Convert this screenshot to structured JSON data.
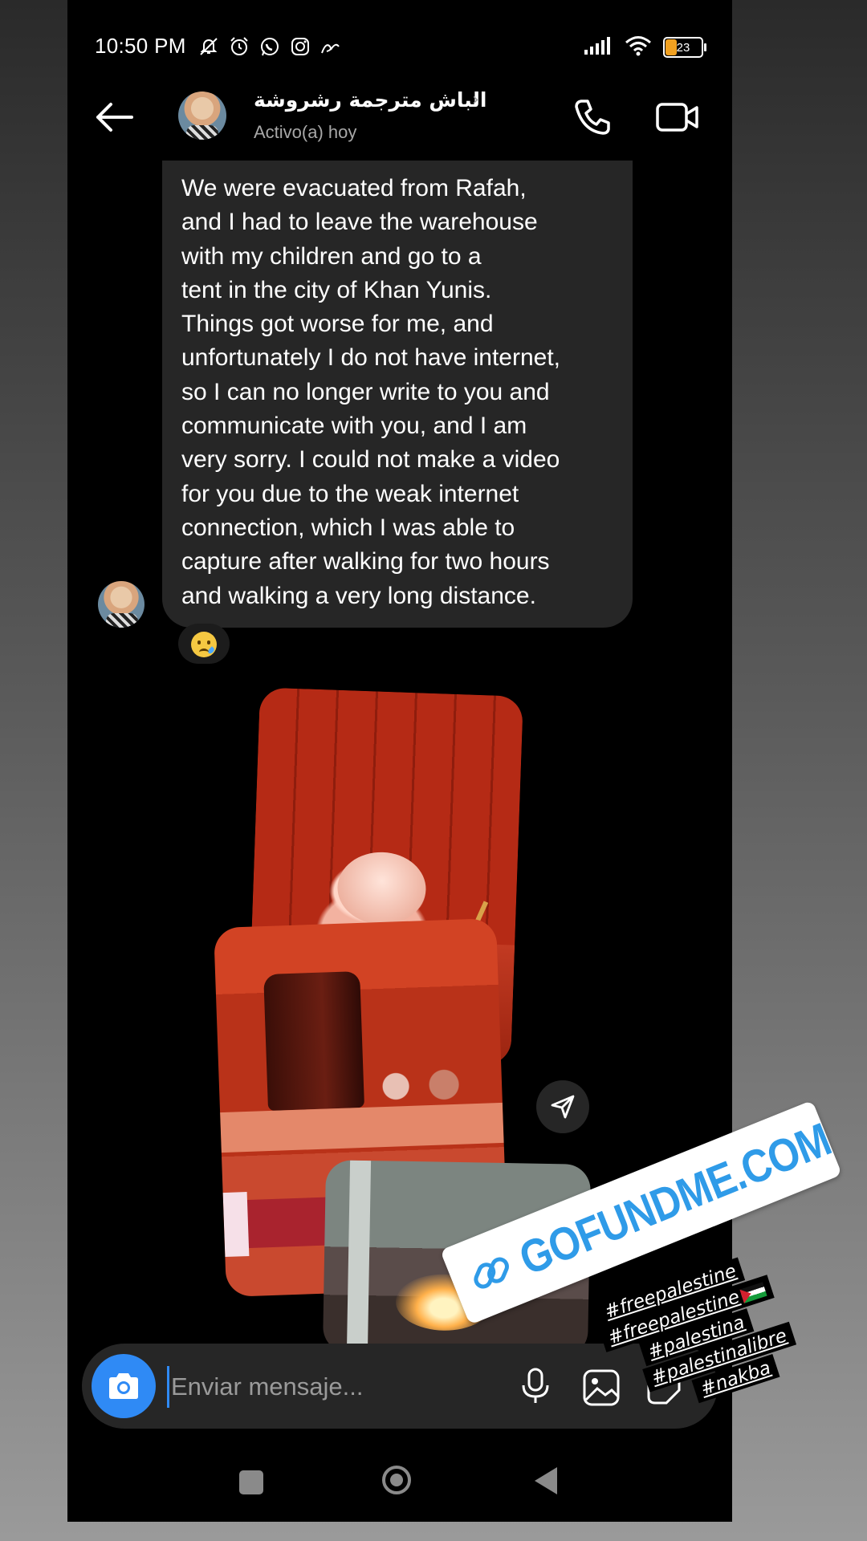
{
  "status_bar": {
    "time": "10:50 PM",
    "battery": "23",
    "left_icons": [
      "mute-icon",
      "alarm-icon",
      "whatsapp-icon",
      "instagram-icon",
      "signature-icon"
    ],
    "right_icons": [
      "signal-icon",
      "wifi-icon",
      "battery-icon"
    ]
  },
  "header": {
    "contact_name": "الباش مترجمة رشروشة",
    "contact_status": "Activo(a) hoy",
    "icons": [
      "back-arrow-icon",
      "phone-icon",
      "video-camera-icon",
      "chevron-right-icon"
    ]
  },
  "message": {
    "text": "We were evacuated from Rafah,\nand I had to leave the warehouse\nwith my children and go to a\ntent in the city of Khan Yunis.\nThings got worse for me, and\nunfortunately I do not have internet,\nso I can no longer write to you and\ncommunicate with you, and I am\nvery sorry. I could not make a video\nfor you due to the weak internet\nconnection, which I was able to\ncapture after walking for two hours\nand walking a very long distance.",
    "reaction": "crying-face-emoji"
  },
  "composer": {
    "placeholder": "Enviar mensaje...",
    "icons": [
      "camera-icon",
      "microphone-icon",
      "gallery-icon",
      "sticker-icon"
    ]
  },
  "stickers": {
    "link_text": "GOFUNDME.COM",
    "hashtags": [
      "#freepalestine",
      "#freepalestine",
      "#palestina",
      "#palestinalibre",
      "#nakba"
    ]
  },
  "colors": {
    "accent": "#2f8af5",
    "bubble": "#262626",
    "link_sticker_text": "#2f9be8"
  }
}
